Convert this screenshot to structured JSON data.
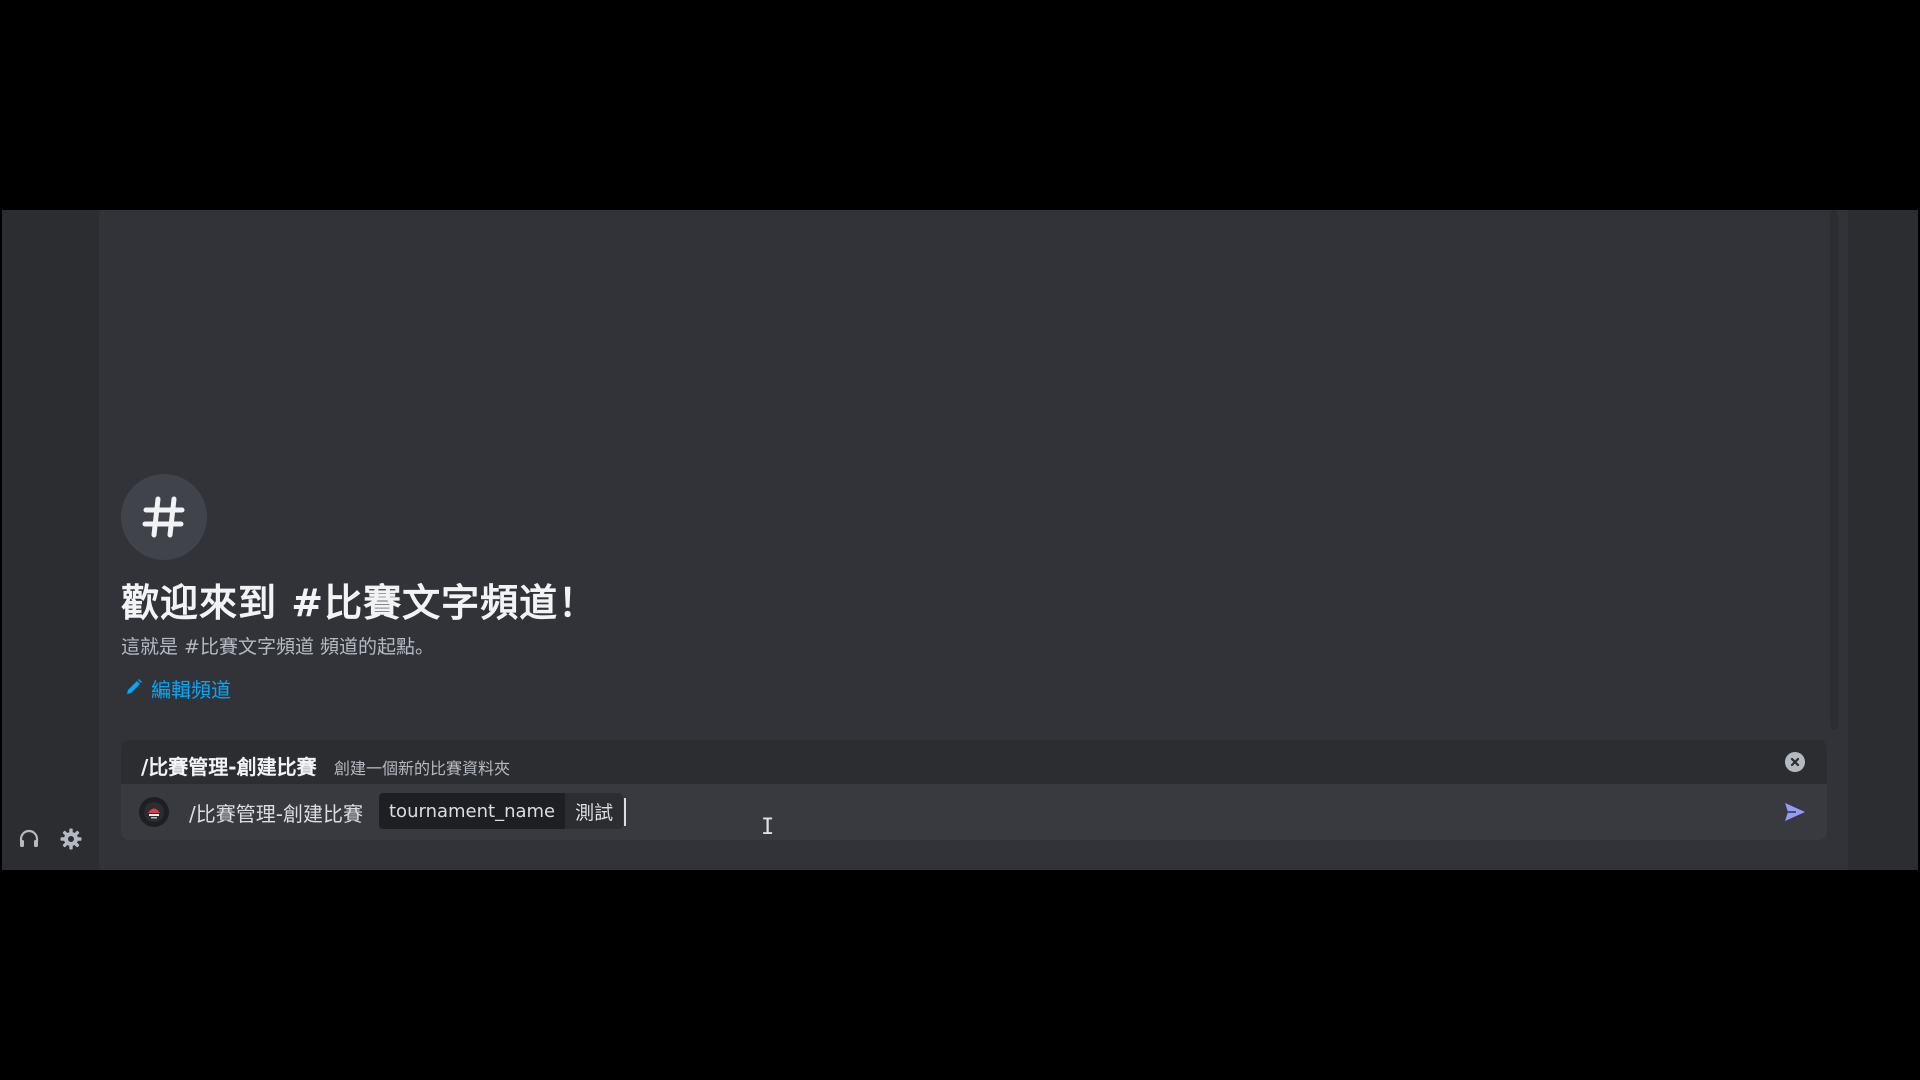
{
  "channel": {
    "welcome_title": "歡迎來到 #比賽文字頻道！",
    "welcome_subtitle": "這就是 #比賽文字頻道 頻道的起點。",
    "edit_label": "編輯頻道"
  },
  "command_popup": {
    "name": "/比賽管理-創建比賽",
    "description": "創建一個新的比賽資料夾"
  },
  "input": {
    "command": "/比賽管理-創建比賽",
    "option_name": "tournament_name",
    "option_value": "測試"
  },
  "colors": {
    "background": "#313338",
    "link": "#00a8fc",
    "send": "#949cf7"
  },
  "icons": {
    "channel": "hash-icon",
    "edit": "pencil-icon",
    "close": "close-circle-icon",
    "send": "send-icon",
    "headset": "headset-icon",
    "settings": "gear-icon"
  }
}
